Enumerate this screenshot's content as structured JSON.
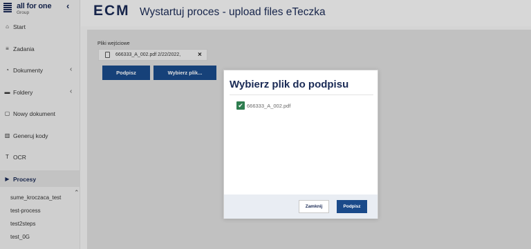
{
  "brand": {
    "name": "all for one",
    "sub": "Group"
  },
  "sidebar": {
    "items": [
      {
        "label": "Start",
        "icon": "home-icon",
        "chevron": ""
      },
      {
        "label": "Zadania",
        "icon": "list-icon",
        "chevron": ""
      },
      {
        "label": "Dokumenty",
        "icon": "documents-icon",
        "chevron": "‹"
      },
      {
        "label": "Foldery",
        "icon": "folder-icon",
        "chevron": "‹"
      },
      {
        "label": "Nowy dokument",
        "icon": "new-document-icon",
        "chevron": ""
      },
      {
        "label": "Generuj kody",
        "icon": "barcode-icon",
        "chevron": ""
      },
      {
        "label": "OCR",
        "icon": "ocr-icon",
        "chevron": ""
      },
      {
        "label": "Procesy",
        "icon": "play-icon",
        "chevron": ""
      }
    ],
    "sub_items": [
      "sume_kroczaca_test",
      "test-process",
      "test2steps",
      "test_0G"
    ]
  },
  "header": {
    "logo": "ECM",
    "title": "Wystartuj proces - upload files eTeczka"
  },
  "main": {
    "files_label": "Pliki wejściowe",
    "file_name": "666333_A_002.pdf 2/22/2022,",
    "sign_button": "Podpisz",
    "choose_button": "Wybierz plik..."
  },
  "modal": {
    "title": "Wybierz plik do podpisu",
    "checkbox_label": "666333_A_002.pdf",
    "close_button": "Zamknij",
    "sign_button": "Podpisz"
  },
  "colors": {
    "brand": "#1a2a55",
    "primary": "#1a4a8a",
    "check": "#2e7d4f"
  }
}
